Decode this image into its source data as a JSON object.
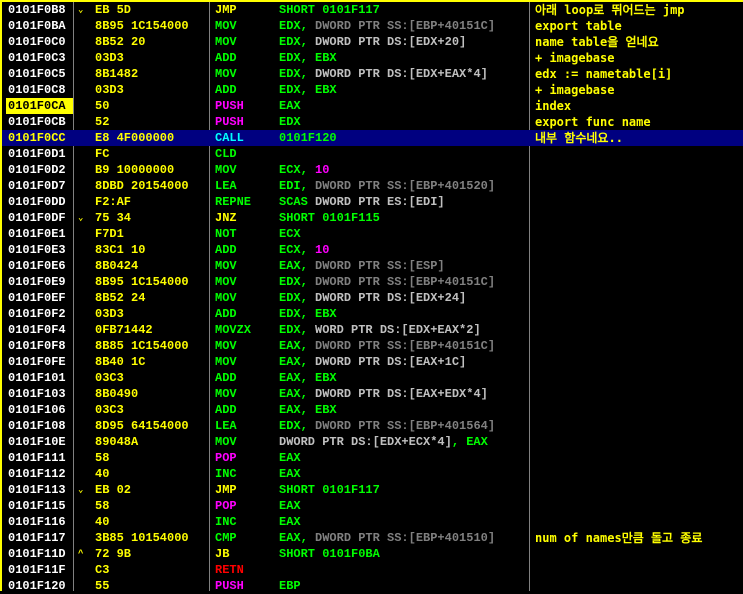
{
  "colors": {
    "address": "#ffffff",
    "hex": "#ffff00",
    "operand_register": "#00ff00",
    "ss_memory": "#808080",
    "ds_memory": "#c0c0c0",
    "immediate": "#ff00ff",
    "comment": "#ffff00",
    "selection": "#000080",
    "highlight": "#ffff00"
  },
  "rows": [
    {
      "addr": "0101F0B8",
      "arrow": "⌄",
      "hex": "EB 5D",
      "mn": "JMP",
      "mt": "jmp",
      "op": [
        [
          "g",
          "SHORT 0101F117"
        ]
      ],
      "cm": "아래 loop로 뛰어드는 jmp"
    },
    {
      "addr": "0101F0BA",
      "hex": "8B95 1C154000",
      "mn": "MOV",
      "mt": "std",
      "op": [
        [
          "g",
          "EDX, "
        ],
        [
          "s",
          "DWORD PTR SS:[EBP+40151C]"
        ]
      ],
      "cm": "export table"
    },
    {
      "addr": "0101F0C0",
      "hex": "8B52 20",
      "mn": "MOV",
      "mt": "std",
      "op": [
        [
          "g",
          "EDX, "
        ],
        [
          "d",
          "DWORD PTR DS:[EDX+20]"
        ]
      ],
      "cm": "name table을 얻네요"
    },
    {
      "addr": "0101F0C3",
      "hex": "03D3",
      "mn": "ADD",
      "mt": "std",
      "op": [
        [
          "g",
          "EDX, EBX"
        ]
      ],
      "cm": "+ imagebase"
    },
    {
      "addr": "0101F0C5",
      "hex": "8B1482",
      "mn": "MOV",
      "mt": "std",
      "op": [
        [
          "g",
          "EDX, "
        ],
        [
          "d",
          "DWORD PTR DS:[EDX+EAX*4]"
        ]
      ],
      "cm": "edx := nametable[i]"
    },
    {
      "addr": "0101F0C8",
      "hex": "03D3",
      "mn": "ADD",
      "mt": "std",
      "op": [
        [
          "g",
          "EDX, EBX"
        ]
      ],
      "cm": "+ imagebase"
    },
    {
      "addr": "0101F0CA",
      "hl": true,
      "hex": "50",
      "mn": "PUSH",
      "mt": "stack",
      "op": [
        [
          "g",
          "EAX"
        ]
      ],
      "cm": "index"
    },
    {
      "addr": "0101F0CB",
      "hex": "52",
      "mn": "PUSH",
      "mt": "stack",
      "op": [
        [
          "g",
          "EDX"
        ]
      ],
      "cm": "export func name"
    },
    {
      "addr": "0101F0CC",
      "sel": true,
      "hex": "E8 4F000000",
      "mn": "CALL",
      "mt": "call",
      "op": [
        [
          "g",
          "0101F120"
        ]
      ],
      "cm": "내부 함수네요.."
    },
    {
      "addr": "0101F0D1",
      "hex": "FC",
      "mn": "CLD",
      "mt": "std",
      "op": []
    },
    {
      "addr": "0101F0D2",
      "hex": "B9 10000000",
      "mn": "MOV",
      "mt": "std",
      "op": [
        [
          "g",
          "ECX, "
        ],
        [
          "i",
          "10"
        ]
      ]
    },
    {
      "addr": "0101F0D7",
      "hex": "8DBD 20154000",
      "mn": "LEA",
      "mt": "std",
      "op": [
        [
          "g",
          "EDI, "
        ],
        [
          "s",
          "DWORD PTR SS:[EBP+401520]"
        ]
      ]
    },
    {
      "addr": "0101F0DD",
      "hex": "F2:AF",
      "mn": "REPNE",
      "mt": "std",
      "op": [
        [
          "g",
          "SCAS "
        ],
        [
          "d",
          "DWORD PTR ES:[EDI]"
        ]
      ]
    },
    {
      "addr": "0101F0DF",
      "arrow": "⌄",
      "hex": "75 34",
      "mn": "JNZ",
      "mt": "jmp",
      "op": [
        [
          "g",
          "SHORT 0101F115"
        ]
      ]
    },
    {
      "addr": "0101F0E1",
      "hex": "F7D1",
      "mn": "NOT",
      "mt": "std",
      "op": [
        [
          "g",
          "ECX"
        ]
      ]
    },
    {
      "addr": "0101F0E3",
      "hex": "83C1 10",
      "mn": "ADD",
      "mt": "std",
      "op": [
        [
          "g",
          "ECX, "
        ],
        [
          "i",
          "10"
        ]
      ]
    },
    {
      "addr": "0101F0E6",
      "hex": "8B0424",
      "mn": "MOV",
      "mt": "std",
      "op": [
        [
          "g",
          "EAX, "
        ],
        [
          "s",
          "DWORD PTR SS:[ESP]"
        ]
      ]
    },
    {
      "addr": "0101F0E9",
      "hex": "8B95 1C154000",
      "mn": "MOV",
      "mt": "std",
      "op": [
        [
          "g",
          "EDX, "
        ],
        [
          "s",
          "DWORD PTR SS:[EBP+40151C]"
        ]
      ]
    },
    {
      "addr": "0101F0EF",
      "hex": "8B52 24",
      "mn": "MOV",
      "mt": "std",
      "op": [
        [
          "g",
          "EDX, "
        ],
        [
          "d",
          "DWORD PTR DS:[EDX+24]"
        ]
      ]
    },
    {
      "addr": "0101F0F2",
      "hex": "03D3",
      "mn": "ADD",
      "mt": "std",
      "op": [
        [
          "g",
          "EDX, EBX"
        ]
      ]
    },
    {
      "addr": "0101F0F4",
      "hex": "0FB71442",
      "mn": "MOVZX",
      "mt": "std",
      "op": [
        [
          "g",
          "EDX, "
        ],
        [
          "d",
          "WORD PTR DS:[EDX+EAX*2]"
        ]
      ]
    },
    {
      "addr": "0101F0F8",
      "hex": "8B85 1C154000",
      "mn": "MOV",
      "mt": "std",
      "op": [
        [
          "g",
          "EAX, "
        ],
        [
          "s",
          "DWORD PTR SS:[EBP+40151C]"
        ]
      ]
    },
    {
      "addr": "0101F0FE",
      "hex": "8B40 1C",
      "mn": "MOV",
      "mt": "std",
      "op": [
        [
          "g",
          "EAX, "
        ],
        [
          "d",
          "DWORD PTR DS:[EAX+1C]"
        ]
      ]
    },
    {
      "addr": "0101F101",
      "hex": "03C3",
      "mn": "ADD",
      "mt": "std",
      "op": [
        [
          "g",
          "EAX, EBX"
        ]
      ]
    },
    {
      "addr": "0101F103",
      "hex": "8B0490",
      "mn": "MOV",
      "mt": "std",
      "op": [
        [
          "g",
          "EAX, "
        ],
        [
          "d",
          "DWORD PTR DS:[EAX+EDX*4]"
        ]
      ]
    },
    {
      "addr": "0101F106",
      "hex": "03C3",
      "mn": "ADD",
      "mt": "std",
      "op": [
        [
          "g",
          "EAX, EBX"
        ]
      ]
    },
    {
      "addr": "0101F108",
      "hex": "8D95 64154000",
      "mn": "LEA",
      "mt": "std",
      "op": [
        [
          "g",
          "EDX, "
        ],
        [
          "s",
          "DWORD PTR SS:[EBP+401564]"
        ]
      ]
    },
    {
      "addr": "0101F10E",
      "hex": "89048A",
      "mn": "MOV",
      "mt": "std",
      "op": [
        [
          "d",
          "DWORD PTR DS:[EDX+ECX*4]"
        ],
        [
          "g",
          ", EAX"
        ]
      ]
    },
    {
      "addr": "0101F111",
      "hex": "58",
      "mn": "POP",
      "mt": "stack",
      "op": [
        [
          "g",
          "EAX"
        ]
      ]
    },
    {
      "addr": "0101F112",
      "hex": "40",
      "mn": "INC",
      "mt": "std",
      "op": [
        [
          "g",
          "EAX"
        ]
      ]
    },
    {
      "addr": "0101F113",
      "arrow": "⌄",
      "hex": "EB 02",
      "mn": "JMP",
      "mt": "jmp",
      "op": [
        [
          "g",
          "SHORT 0101F117"
        ]
      ]
    },
    {
      "addr": "0101F115",
      "hex": "58",
      "mn": "POP",
      "mt": "stack",
      "op": [
        [
          "g",
          "EAX"
        ]
      ]
    },
    {
      "addr": "0101F116",
      "hex": "40",
      "mn": "INC",
      "mt": "std",
      "op": [
        [
          "g",
          "EAX"
        ]
      ]
    },
    {
      "addr": "0101F117",
      "hex": "3B85 10154000",
      "mn": "CMP",
      "mt": "std",
      "op": [
        [
          "g",
          "EAX, "
        ],
        [
          "s",
          "DWORD PTR SS:[EBP+401510]"
        ]
      ],
      "cm": "num of names만큼 돌고 종료"
    },
    {
      "addr": "0101F11D",
      "arrow": "^",
      "hex": "72 9B",
      "mn": "JB",
      "mt": "jmp",
      "op": [
        [
          "g",
          "SHORT 0101F0BA"
        ]
      ]
    },
    {
      "addr": "0101F11F",
      "hex": "C3",
      "mn": "RETN",
      "mt": "ret",
      "op": []
    },
    {
      "addr": "0101F120",
      "hex": "55",
      "mn": "PUSH",
      "mt": "stack",
      "op": [
        [
          "g",
          "EBP"
        ]
      ]
    }
  ]
}
